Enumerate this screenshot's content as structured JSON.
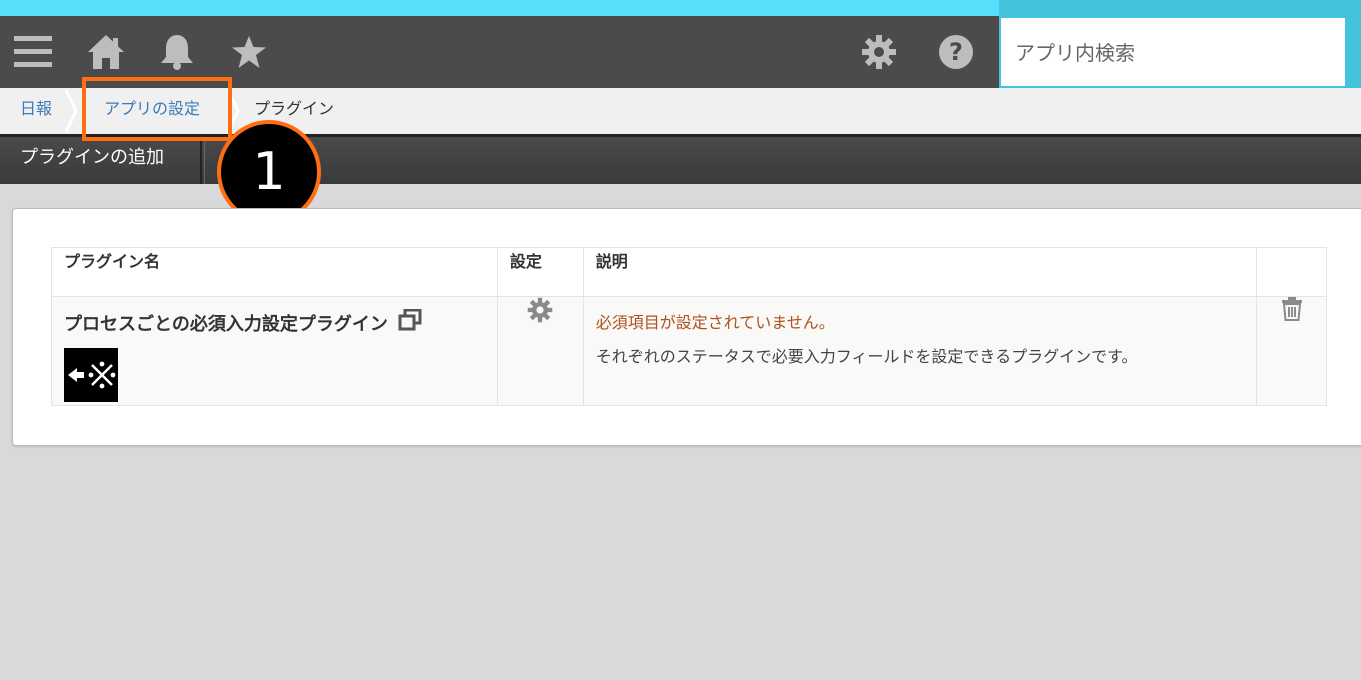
{
  "header": {
    "icons": [
      "menu-icon",
      "home-icon",
      "bell-icon",
      "star-icon",
      "gear-icon",
      "help-icon"
    ],
    "search_placeholder": "アプリ内検索"
  },
  "breadcrumb": {
    "items": [
      {
        "label": "日報",
        "type": "link"
      },
      {
        "label": "アプリの設定",
        "type": "link"
      },
      {
        "label": "プラグイン",
        "type": "current"
      }
    ]
  },
  "toolbar": {
    "add_plugin_label": "プラグインの追加"
  },
  "annotation": {
    "step_number": "1"
  },
  "table": {
    "columns": [
      "プラグイン名",
      "設定",
      "説明",
      ""
    ],
    "rows": [
      {
        "name": "プロセスごとの必須入力設定プラグイン",
        "warning": "必須項目が設定されていません。",
        "description": "それぞれのステータスで必要入力フィールドを設定できるプラグインです。"
      }
    ]
  },
  "colors": {
    "accent_cyan": "#55dffa",
    "header_bg": "#4b4b4b",
    "highlight_orange": "#ff6e14",
    "warning_text": "#b0501e",
    "link_blue": "#3a7ab8"
  }
}
